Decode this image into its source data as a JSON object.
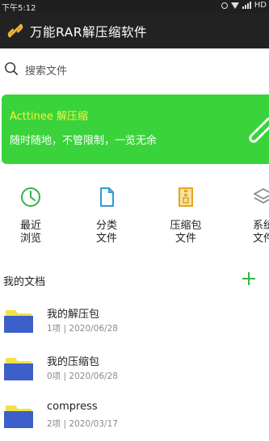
{
  "status_bar": {
    "time": "下午5:12",
    "network": "HD"
  },
  "app_bar": {
    "title": "万能RAR解压缩软件",
    "logo_icon": "link-icon"
  },
  "search": {
    "placeholder": "搜索文件",
    "icon": "search-icon"
  },
  "banner": {
    "title": "Acttinee 解压缩",
    "subtitle": "随时随地，不管限制，一览无余",
    "background": "#3ad33c",
    "title_color": "#f7f33d"
  },
  "categories": [
    {
      "line1": "最近",
      "line2": "浏览",
      "icon": "clock-icon",
      "color": "#33b24a"
    },
    {
      "line1": "分类",
      "line2": "文件",
      "icon": "document-icon",
      "color": "#2e9ad6"
    },
    {
      "line1": "压缩包",
      "line2": "文件",
      "icon": "archive-icon",
      "color": "#e4a520"
    },
    {
      "line1": "系统",
      "line2": "文件",
      "icon": "layers-icon",
      "color": "#888888"
    }
  ],
  "documents": {
    "header": "我的文档",
    "add_icon": "plus-icon",
    "items": [
      {
        "name": "我的解压包",
        "count": "1项",
        "date": "2020/06/28"
      },
      {
        "name": "我的压缩包",
        "count": "0项",
        "date": "2020/06/28"
      },
      {
        "name": "compress",
        "count": "2项",
        "date": "2020/03/17"
      }
    ],
    "separator": "|"
  }
}
